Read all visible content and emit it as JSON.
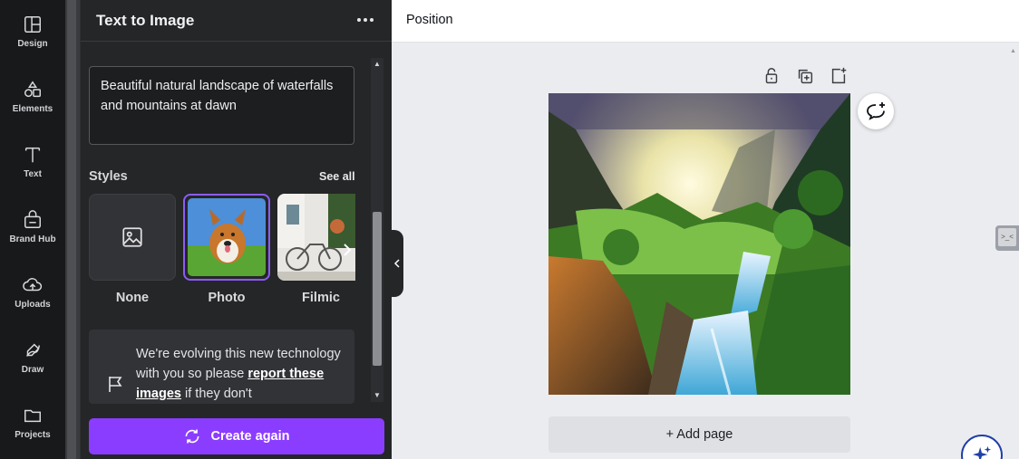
{
  "rail": {
    "items": [
      {
        "label": "Design",
        "icon": "design-icon"
      },
      {
        "label": "Elements",
        "icon": "elements-icon"
      },
      {
        "label": "Text",
        "icon": "text-icon"
      },
      {
        "label": "Brand Hub",
        "icon": "brand-hub-icon"
      },
      {
        "label": "Uploads",
        "icon": "uploads-icon"
      },
      {
        "label": "Draw",
        "icon": "draw-icon"
      },
      {
        "label": "Projects",
        "icon": "projects-icon"
      }
    ]
  },
  "panel": {
    "title": "Text to Image",
    "prompt": "Beautiful natural landscape of waterfalls and mountains at dawn",
    "styles_label": "Styles",
    "see_all": "See all",
    "styles": [
      {
        "name": "None",
        "selected": false
      },
      {
        "name": "Photo",
        "selected": true
      },
      {
        "name": "Filmic",
        "selected": false
      }
    ],
    "notice_text_before": "We're evolving this new technology with you so please ",
    "notice_link": "report these images",
    "notice_text_after": " if they don't",
    "create_again": "Create again"
  },
  "topbar": {
    "position_label": "Position"
  },
  "canvas": {
    "add_page": "+ Add page"
  },
  "colors": {
    "accent": "#8b3dff",
    "selected_border": "#8b5cf6",
    "panel_bg": "#252627",
    "rail_bg": "#18191b",
    "canvas_bg": "#ebecf0"
  }
}
